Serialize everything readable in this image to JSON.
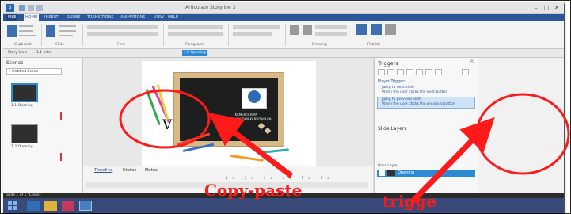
{
  "window": {
    "title": "Articulate Storyline 3",
    "controls": [
      "–",
      "□",
      "✕"
    ]
  },
  "ribbon_tabs": [
    "FILE",
    "HOME",
    "INSERT",
    "SLIDES",
    "TRANSITIONS",
    "ANIMATIONS",
    "VIEW",
    "HELP"
  ],
  "ribbon_groups": [
    "Clipboard",
    "Slide",
    "Font",
    "Paragraph",
    "Drawing",
    "Publish"
  ],
  "slide_tabs": [
    "Story View",
    "1.1 Intro",
    "1.2 Opening"
  ],
  "scenes": {
    "title": "Scenes",
    "selector": "1 Untitled Scene",
    "thumbs": [
      "1.1 Opening",
      "1.2 Opening"
    ]
  },
  "slide": {
    "text_v": "V",
    "badge_lines": [
      "KEMENTERIAN",
      "PENDIDIKAN DAN KEBUDAYAAN"
    ]
  },
  "timeline": {
    "tabs": [
      "Timeline",
      "States",
      "Notes"
    ],
    "ruler": [
      "1s",
      "2s",
      "3s",
      "4s",
      "5s",
      "6s"
    ]
  },
  "triggers": {
    "title": "Triggers",
    "section": "Player Triggers",
    "items": [
      {
        "action": "Jump to next slide",
        "condition": "When the user clicks the next button"
      },
      {
        "action": "Jump to previous slide",
        "condition": "When the user clicks the previous button"
      }
    ]
  },
  "slide_layers": {
    "title": "Slide Layers",
    "base_label": "Base Layer",
    "layer_name": "Opening"
  },
  "status_bar": {
    "text": "Slide 1 of 1   \"Clean\""
  },
  "taskbar": {
    "clock_time": "",
    "clock_date": ""
  },
  "annotations": {
    "copy_paste": "Copy-paste",
    "trigger": "trigge"
  },
  "colors": {
    "annotation_red": "#ff1a1a",
    "ribbon_blue": "#2b579a",
    "selection_blue": "#2b8bd6"
  }
}
